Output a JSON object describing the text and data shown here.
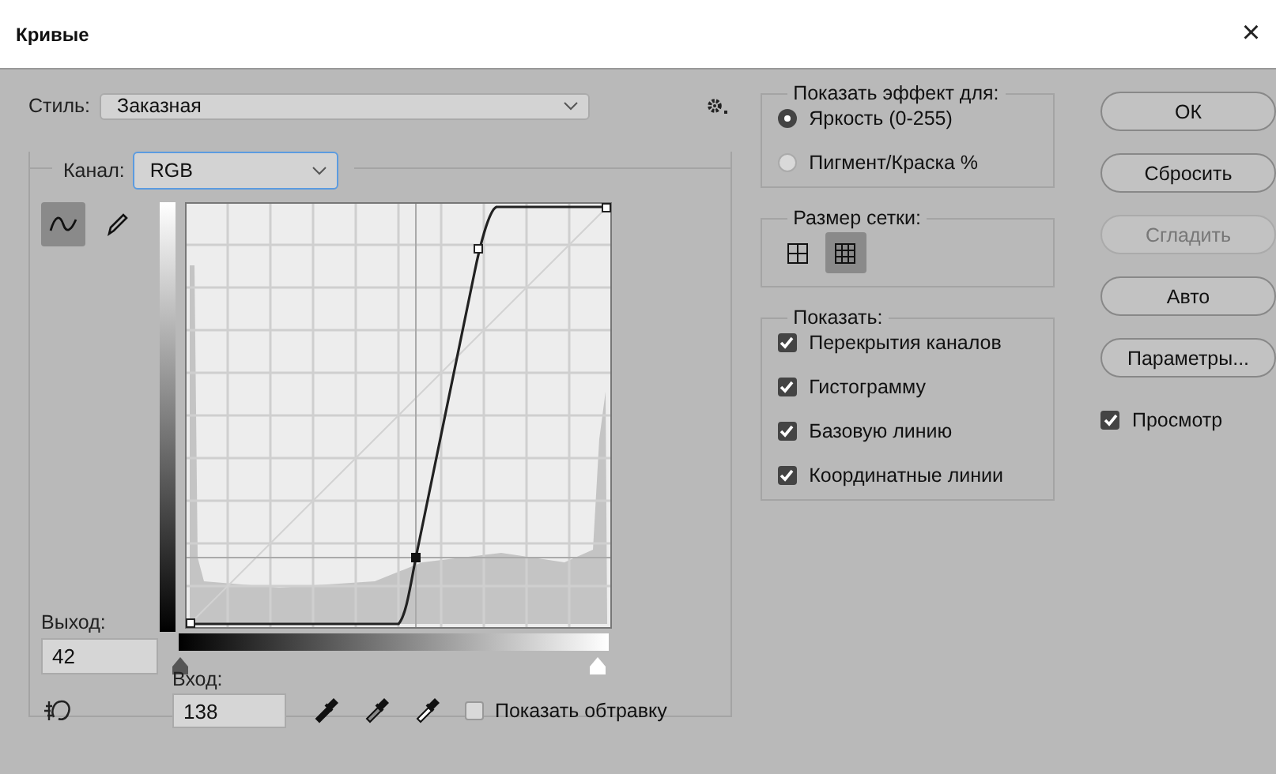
{
  "window": {
    "title": "Кривые",
    "close": "×"
  },
  "style": {
    "label": "Стиль:",
    "value": "Заказная"
  },
  "channel": {
    "label": "Канал:",
    "value": "RGB"
  },
  "tools": [
    {
      "kind": "curve",
      "selected": true
    },
    {
      "kind": "pencil",
      "selected": false
    }
  ],
  "output": {
    "label": "Выход:",
    "value": "42"
  },
  "input": {
    "label": "Вход:",
    "value": "138"
  },
  "show_clipping": {
    "label": "Показать обтравку",
    "checked": false
  },
  "effect_group": {
    "title": "Показать эффект для:",
    "options": [
      {
        "label": "Яркость (0-255)",
        "selected": true
      },
      {
        "label": "Пигмент/Краска %",
        "selected": false
      }
    ]
  },
  "grid_group": {
    "title": "Размер сетки:",
    "options": [
      {
        "kind": "simple",
        "selected": false
      },
      {
        "kind": "detailed",
        "selected": true
      }
    ]
  },
  "show_group": {
    "title": "Показать:",
    "options": [
      {
        "kind": "overlays",
        "label": "Перекрытия каналов",
        "checked": true
      },
      {
        "kind": "histogram",
        "label": "Гистограмму",
        "checked": true
      },
      {
        "kind": "baseline",
        "label": "Базовую линию",
        "checked": true
      },
      {
        "kind": "intersection",
        "label": "Координатные линии",
        "checked": true
      }
    ]
  },
  "buttons": [
    {
      "label": "ОК",
      "disabled": false
    },
    {
      "label": "Сбросить",
      "disabled": false
    },
    {
      "label": "Сгладить",
      "disabled": true
    },
    {
      "label": "Авто",
      "disabled": false
    },
    {
      "label": "Параметры...",
      "disabled": false
    }
  ],
  "preview": {
    "label": "Просмотр",
    "checked": true
  }
}
